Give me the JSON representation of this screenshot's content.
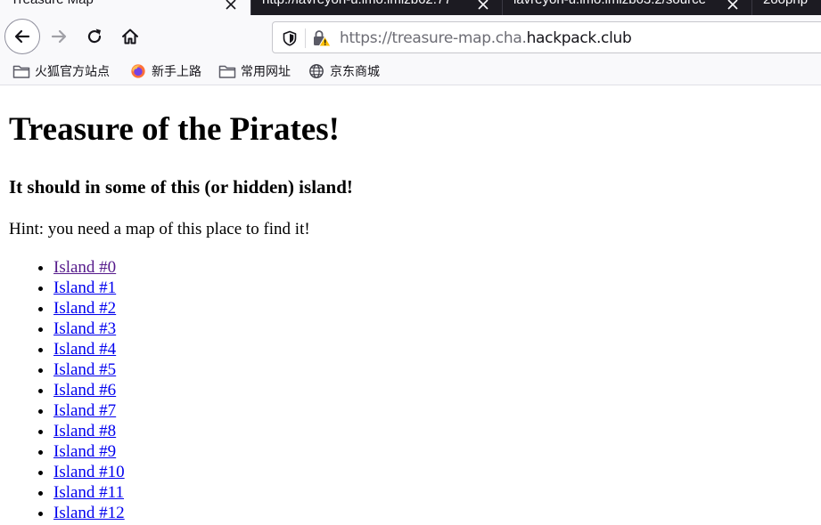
{
  "tabs": [
    {
      "title": "Treasure Map",
      "active": true
    },
    {
      "title": "http://lavreyon-u.lmo.lmlzb62.77",
      "active": false
    },
    {
      "title": "lavreyon-u.lmo.lmlzb63.2/source",
      "active": false
    },
    {
      "title": "2oophp",
      "active": false
    }
  ],
  "toolbar": {
    "back_icon": "back-arrow-icon",
    "forward_icon": "forward-arrow-icon",
    "reload_icon": "reload-icon",
    "home_icon": "home-icon"
  },
  "urlbar": {
    "url_prefix": "https://treasure-map.cha.",
    "url_host": "hackpack.club",
    "tracking_icon": "shield-icon",
    "security_icon": "insecure-lock-warning-icon"
  },
  "bookmarks": [
    {
      "label": "火狐官方站点",
      "icon": "folder-icon"
    },
    {
      "label": "新手上路",
      "icon": "firefox-icon"
    },
    {
      "label": "常用网址",
      "icon": "folder-icon"
    },
    {
      "label": "京东商城",
      "icon": "globe-icon"
    }
  ],
  "page": {
    "title": "Treasure of the Pirates!",
    "subtitle": "It should in some of this (or hidden) island!",
    "hint": "Hint: you need a map of this place to find it!",
    "islands": [
      "Island #0",
      "Island #1",
      "Island #2",
      "Island #3",
      "Island #4",
      "Island #5",
      "Island #6",
      "Island #7",
      "Island #8",
      "Island #9",
      "Island #10",
      "Island #11",
      "Island #12"
    ]
  },
  "colors": {
    "link": "#0000ee",
    "visited_link": "#551a8b",
    "tab_strip": "#1c1b22",
    "toolbar": "#f9f9fb"
  }
}
